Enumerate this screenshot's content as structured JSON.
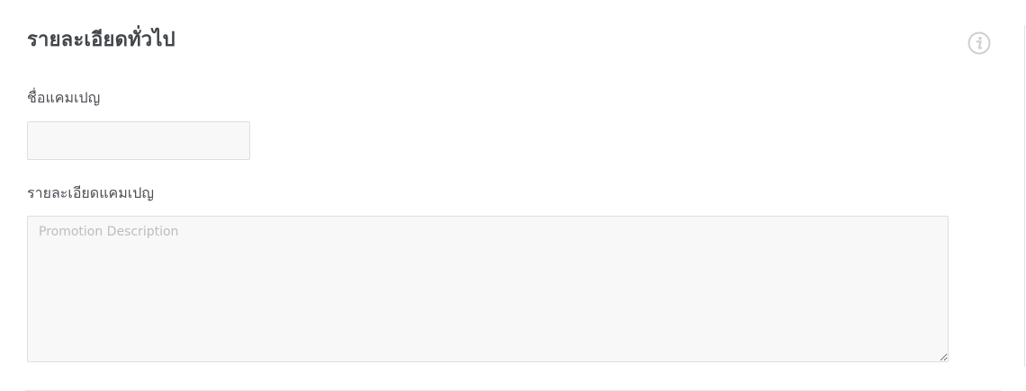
{
  "section": {
    "title": "รายละเอียดทั่วไป",
    "info_icon": "info-circle-icon"
  },
  "fields": {
    "campaign_name": {
      "label": "ชื่อแคมเปญ",
      "value": ""
    },
    "campaign_description": {
      "label": "รายละเอียดแคมเปญ",
      "value": "",
      "placeholder": "Promotion Description"
    }
  },
  "colors": {
    "title": "#41464b",
    "field_background": "#f8f8f8",
    "field_border": "#dedede",
    "icon": "#cfcfcf"
  }
}
